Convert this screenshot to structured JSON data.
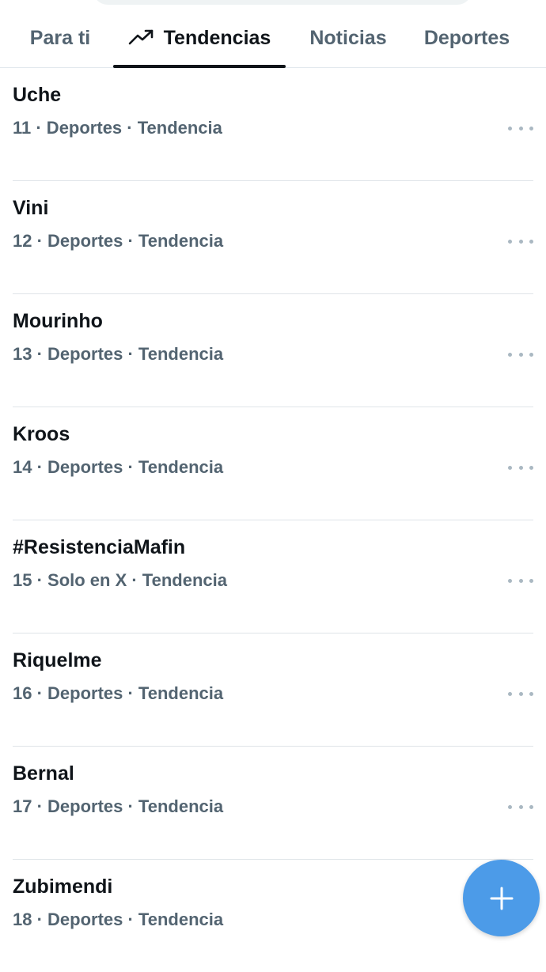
{
  "tabs": [
    {
      "label": "Para ti",
      "active": false
    },
    {
      "label": "Tendencias",
      "active": true,
      "icon": "trending-icon"
    },
    {
      "label": "Noticias",
      "active": false
    },
    {
      "label": "Deportes",
      "active": false
    }
  ],
  "trends": [
    {
      "name": "Uche",
      "meta": "11 · Deportes · Tendencia"
    },
    {
      "name": "Vini",
      "meta": "12 · Deportes · Tendencia"
    },
    {
      "name": "Mourinho",
      "meta": "13 · Deportes · Tendencia"
    },
    {
      "name": "Kroos",
      "meta": "14 · Deportes · Tendencia"
    },
    {
      "name": "#ResistenciaMafin",
      "meta": "15 · Solo en X · Tendencia"
    },
    {
      "name": "Riquelme",
      "meta": "16 · Deportes · Tendencia"
    },
    {
      "name": "Bernal",
      "meta": "17 · Deportes · Tendencia"
    },
    {
      "name": "Zubimendi",
      "meta": "18 · Deportes · Tendencia"
    }
  ],
  "more_icon": "more-horizontal-icon",
  "fab": {
    "icon": "plus-icon",
    "color": "#4c9be8"
  },
  "colors": {
    "text_primary": "#0f1419",
    "text_secondary": "#536471",
    "divider": "#dfe4e8"
  }
}
